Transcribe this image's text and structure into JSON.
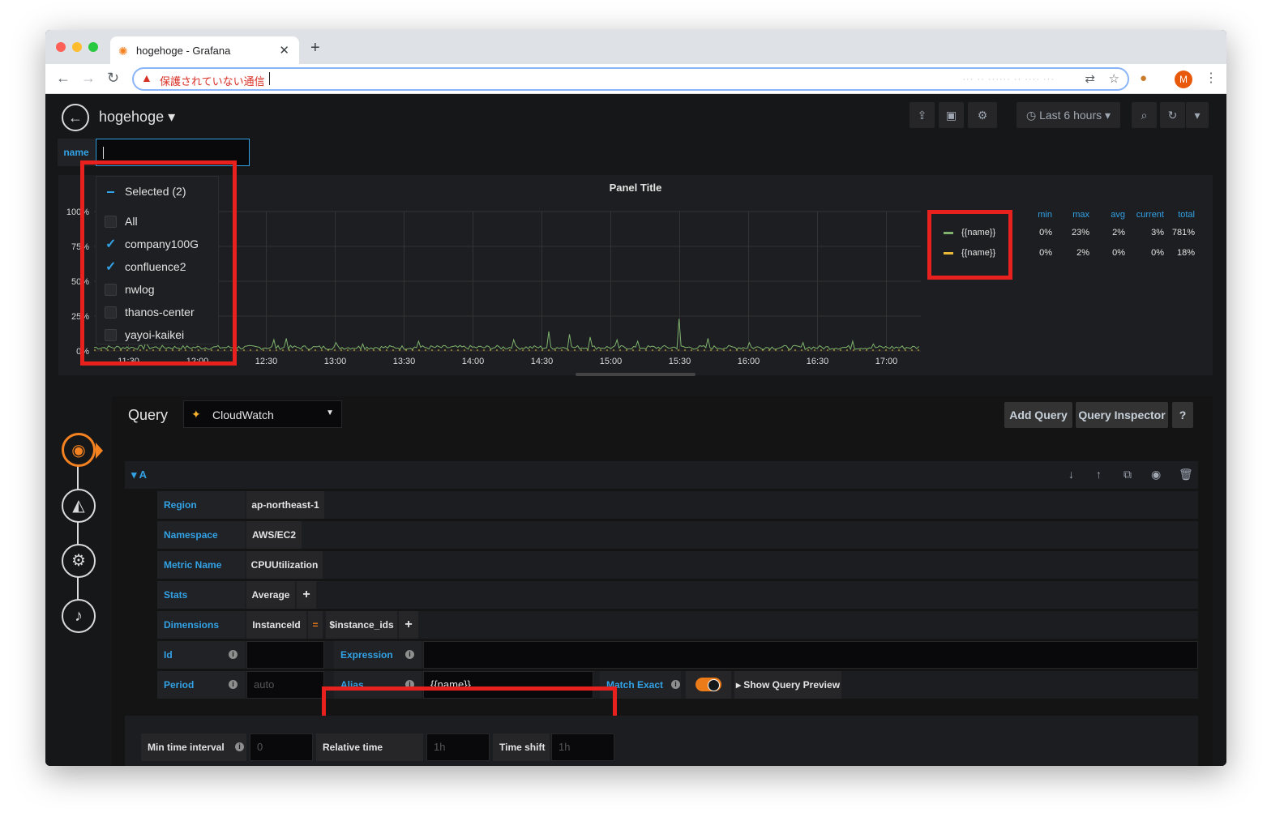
{
  "browser": {
    "tab_title": "hogehoge - Grafana",
    "close": "✕",
    "new_tab": "+",
    "security_label": "保護されていない通信",
    "url_blurred": "··· ·· ······ ·· ···· ···",
    "avatar_letter": "M"
  },
  "dashboard": {
    "title": "hogehoge ▾",
    "time_range": "Last 6 hours"
  },
  "variable": {
    "label": "name",
    "dropdown": {
      "selected_header": "Selected (2)",
      "options": [
        {
          "label": "All",
          "checked": false
        },
        {
          "label": "company100G",
          "checked": true
        },
        {
          "label": "confluence2",
          "checked": true
        },
        {
          "label": "nwlog",
          "checked": false
        },
        {
          "label": "thanos-center",
          "checked": false
        },
        {
          "label": "yayoi-kaikei",
          "checked": false
        }
      ]
    }
  },
  "panel": {
    "title": "Panel Title"
  },
  "chart_data": {
    "type": "line",
    "title": "Panel Title",
    "y_ticks": [
      "100%",
      "75%",
      "50%",
      "25%",
      "0%"
    ],
    "x_ticks": [
      "11:30",
      "12:00",
      "12:30",
      "13:00",
      "13:30",
      "14:00",
      "14:30",
      "15:00",
      "15:30",
      "16:00",
      "16:30",
      "17:00"
    ],
    "ylim": [
      0,
      100
    ],
    "grid": true,
    "legend_position": "right",
    "legend_columns": [
      "min",
      "max",
      "avg",
      "current",
      "total"
    ],
    "series": [
      {
        "name": "{{name}}",
        "color": "#7eb26d",
        "min": "0%",
        "max": "23%",
        "avg": "2%",
        "current": "3%",
        "total": "781%",
        "peaks": [
          [
            11.62,
            6
          ],
          [
            12.55,
            8
          ],
          [
            12.65,
            9
          ],
          [
            13.0,
            6
          ],
          [
            13.2,
            5
          ],
          [
            13.6,
            7
          ],
          [
            14.3,
            8
          ],
          [
            14.55,
            14
          ],
          [
            14.7,
            12
          ],
          [
            14.85,
            10
          ],
          [
            15.05,
            8
          ],
          [
            15.2,
            7
          ],
          [
            15.5,
            23
          ],
          [
            15.7,
            9
          ],
          [
            16.0,
            6
          ],
          [
            16.4,
            6
          ],
          [
            16.75,
            7
          ],
          [
            16.9,
            5
          ]
        ]
      },
      {
        "name": "{{name}}",
        "color": "#eab839",
        "min": "0%",
        "max": "2%",
        "avg": "0%",
        "current": "0%",
        "total": "18%"
      }
    ]
  },
  "query": {
    "title": "Query",
    "datasource": "CloudWatch",
    "add_query": "Add Query",
    "query_inspector": "Query Inspector",
    "help": "?",
    "ref_id": "A",
    "region_label": "Region",
    "region_value": "ap-northeast-1",
    "namespace_label": "Namespace",
    "namespace_value": "AWS/EC2",
    "metric_label": "Metric Name",
    "metric_value": "CPUUtilization",
    "stats_label": "Stats",
    "stats_value": "Average",
    "dimensions_label": "Dimensions",
    "dimension_key": "InstanceId",
    "dimension_op": "=",
    "dimension_value": "$instance_ids",
    "id_label": "Id",
    "expression_label": "Expression",
    "period_label": "Period",
    "period_placeholder": "auto",
    "alias_label": "Alias",
    "alias_value": "{{name}}",
    "match_exact_label": "Match Exact",
    "show_preview": "▸ Show Query Preview",
    "plus": "+"
  },
  "options": {
    "min_interval_label": "Min time interval",
    "min_interval_placeholder": "0",
    "relative_time_label": "Relative time",
    "relative_time_placeholder": "1h",
    "time_shift_label": "Time shift",
    "time_shift_placeholder": "1h"
  }
}
